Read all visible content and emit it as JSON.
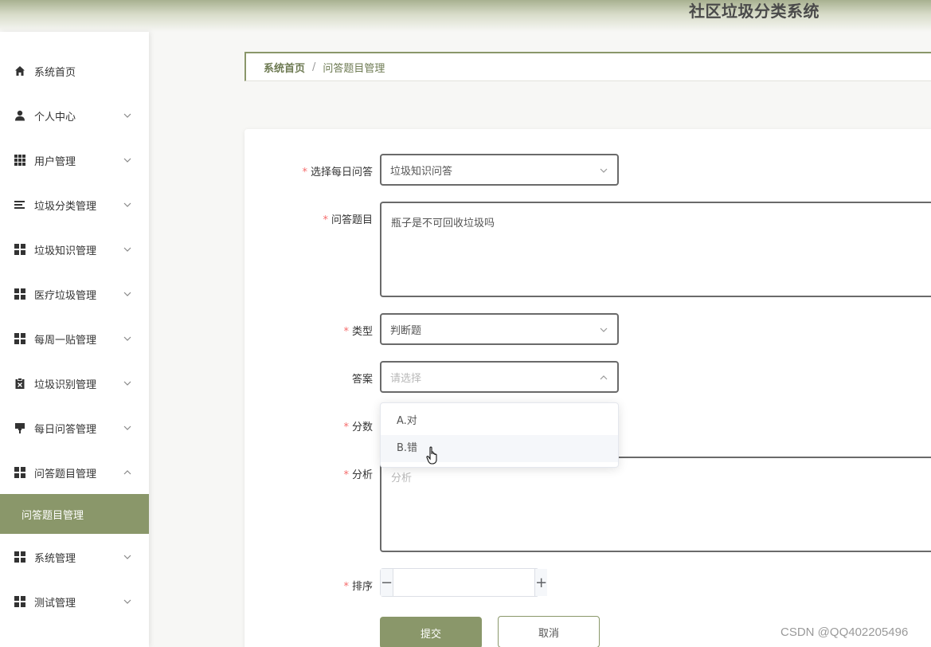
{
  "app": {
    "title": "社区垃圾分类系统"
  },
  "sidebar": {
    "items": [
      {
        "label": "系统首页",
        "icon": "home-icon"
      },
      {
        "label": "个人中心",
        "icon": "user-icon"
      },
      {
        "label": "用户管理",
        "icon": "grid-icon"
      },
      {
        "label": "垃圾分类管理",
        "icon": "list-icon"
      },
      {
        "label": "垃圾知识管理",
        "icon": "apps-icon"
      },
      {
        "label": "医疗垃圾管理",
        "icon": "apps-icon"
      },
      {
        "label": "每周一贴管理",
        "icon": "apps-icon"
      },
      {
        "label": "垃圾识别管理",
        "icon": "clipboard-icon"
      },
      {
        "label": "每日问答管理",
        "icon": "brush-icon"
      },
      {
        "label": "问答题目管理",
        "icon": "apps-icon"
      },
      {
        "label": "系统管理",
        "icon": "apps-icon"
      },
      {
        "label": "测试管理",
        "icon": "apps-icon"
      }
    ],
    "active_sub": "问答题目管理"
  },
  "breadcrumb": {
    "home": "系统首页",
    "separator": "/",
    "current": "问答题目管理"
  },
  "form": {
    "daily_quiz": {
      "label": "选择每日问答",
      "value": "垃圾知识问答"
    },
    "question": {
      "label": "问答题目",
      "value": "瓶子是不可回收垃圾吗"
    },
    "type": {
      "label": "类型",
      "value": "判断题"
    },
    "answer": {
      "label": "答案",
      "placeholder": "请选择",
      "options": [
        "A.对",
        "B.错"
      ],
      "hovered_option": "B.错"
    },
    "score": {
      "label": "分数"
    },
    "analysis": {
      "label": "分析",
      "placeholder": "分析"
    },
    "order": {
      "label": "排序",
      "minus": "−",
      "plus": "+"
    },
    "required_mark": "*",
    "submit_label": "提交",
    "cancel_label": "取消"
  },
  "watermark": "CSDN @QQ402205496",
  "colors": {
    "accent": "#8a976a",
    "required": "#f56c6c"
  }
}
